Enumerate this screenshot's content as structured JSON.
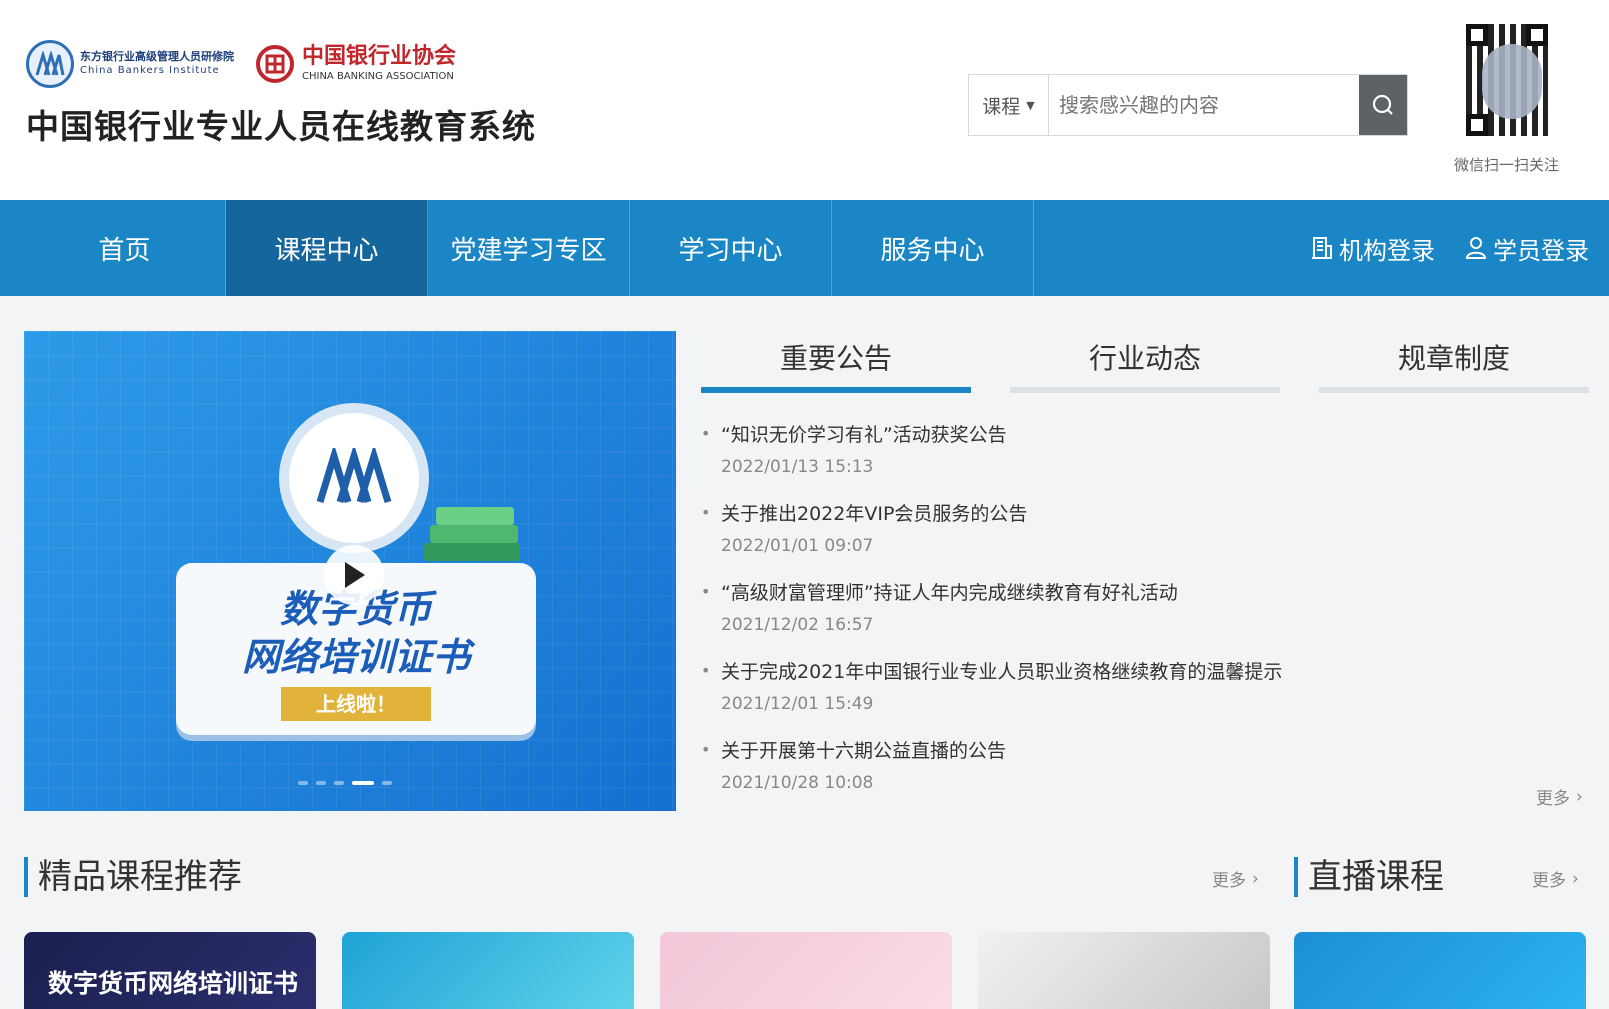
{
  "header": {
    "cbi_name_cn": "东方银行业高级管理人员研修院",
    "cbi_name_en": "China Bankers Institute",
    "cba_name_cn": "中国银行业协会",
    "cba_name_en": "CHINA BANKING ASSOCIATION",
    "site_title": "中国银行业专业人员在线教育系统",
    "search": {
      "category": "课程",
      "placeholder": "搜索感兴趣的内容"
    },
    "qr_label": "微信扫一扫关注"
  },
  "nav": {
    "items": [
      {
        "label": "首页"
      },
      {
        "label": "课程中心"
      },
      {
        "label": "党建学习专区"
      },
      {
        "label": "学习中心"
      },
      {
        "label": "服务中心"
      }
    ],
    "org_login": "机构登录",
    "student_login": "学员登录"
  },
  "banner": {
    "line1": "数字货币",
    "line2": "网络培训证书",
    "tag": "上线啦！",
    "slide_count": 5,
    "active_slide": 4
  },
  "notices": {
    "tabs": [
      {
        "label": "重要公告"
      },
      {
        "label": "行业动态"
      },
      {
        "label": "规章制度"
      }
    ],
    "items": [
      {
        "title": "“知识无价学习有礼”活动获奖公告",
        "date": "2022/01/13 15:13"
      },
      {
        "title": "关于推出2022年VIP会员服务的公告",
        "date": "2022/01/01 09:07"
      },
      {
        "title": "“高级财富管理师”持证人年内完成继续教育有好礼活动",
        "date": "2021/12/02 16:57"
      },
      {
        "title": "关于完成2021年中国银行业专业人员职业资格继续教育的温馨提示",
        "date": "2021/12/01 15:49"
      },
      {
        "title": "关于开展第十六期公益直播的公告",
        "date": "2021/10/28 10:08"
      }
    ],
    "more": "更多"
  },
  "sections": {
    "featured_title": "精品课程推荐",
    "featured_more": "更多",
    "live_title": "直播课程",
    "live_more": "更多"
  },
  "cards": {
    "card1_title": "数字货币网络培训证书"
  },
  "colors": {
    "nav_bg": "#1b86c6",
    "nav_active": "#14669c",
    "accent": "#1b86c6",
    "brand_red": "#c0272d"
  }
}
